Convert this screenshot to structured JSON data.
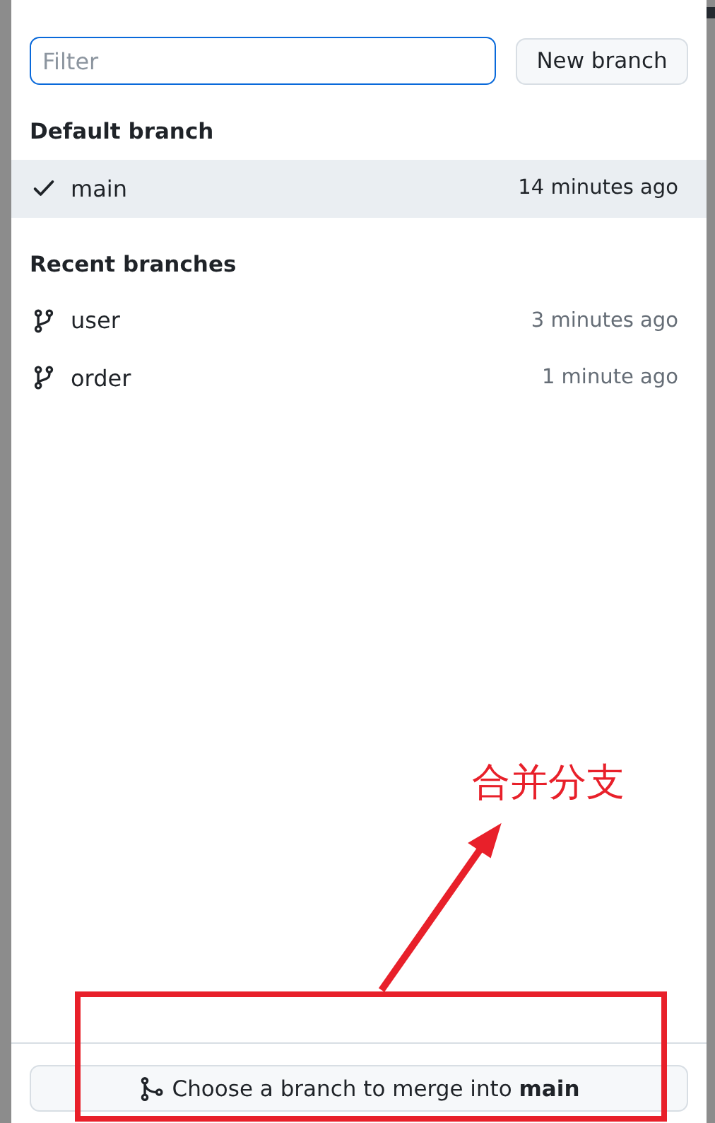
{
  "filter": {
    "placeholder": "Filter"
  },
  "new_branch_button": "New branch",
  "sections": [
    {
      "heading": "Default branch",
      "branches": [
        {
          "name": "main",
          "time": "14 minutes ago",
          "selected": true
        }
      ]
    },
    {
      "heading": "Recent branches",
      "branches": [
        {
          "name": "user",
          "time": "3 minutes ago",
          "selected": false
        },
        {
          "name": "order",
          "time": "1 minute ago",
          "selected": false
        }
      ]
    }
  ],
  "merge_button": "Choose a branch to merge into **main**",
  "annotation": {
    "text": "合并分支",
    "color": "#e8202a"
  }
}
